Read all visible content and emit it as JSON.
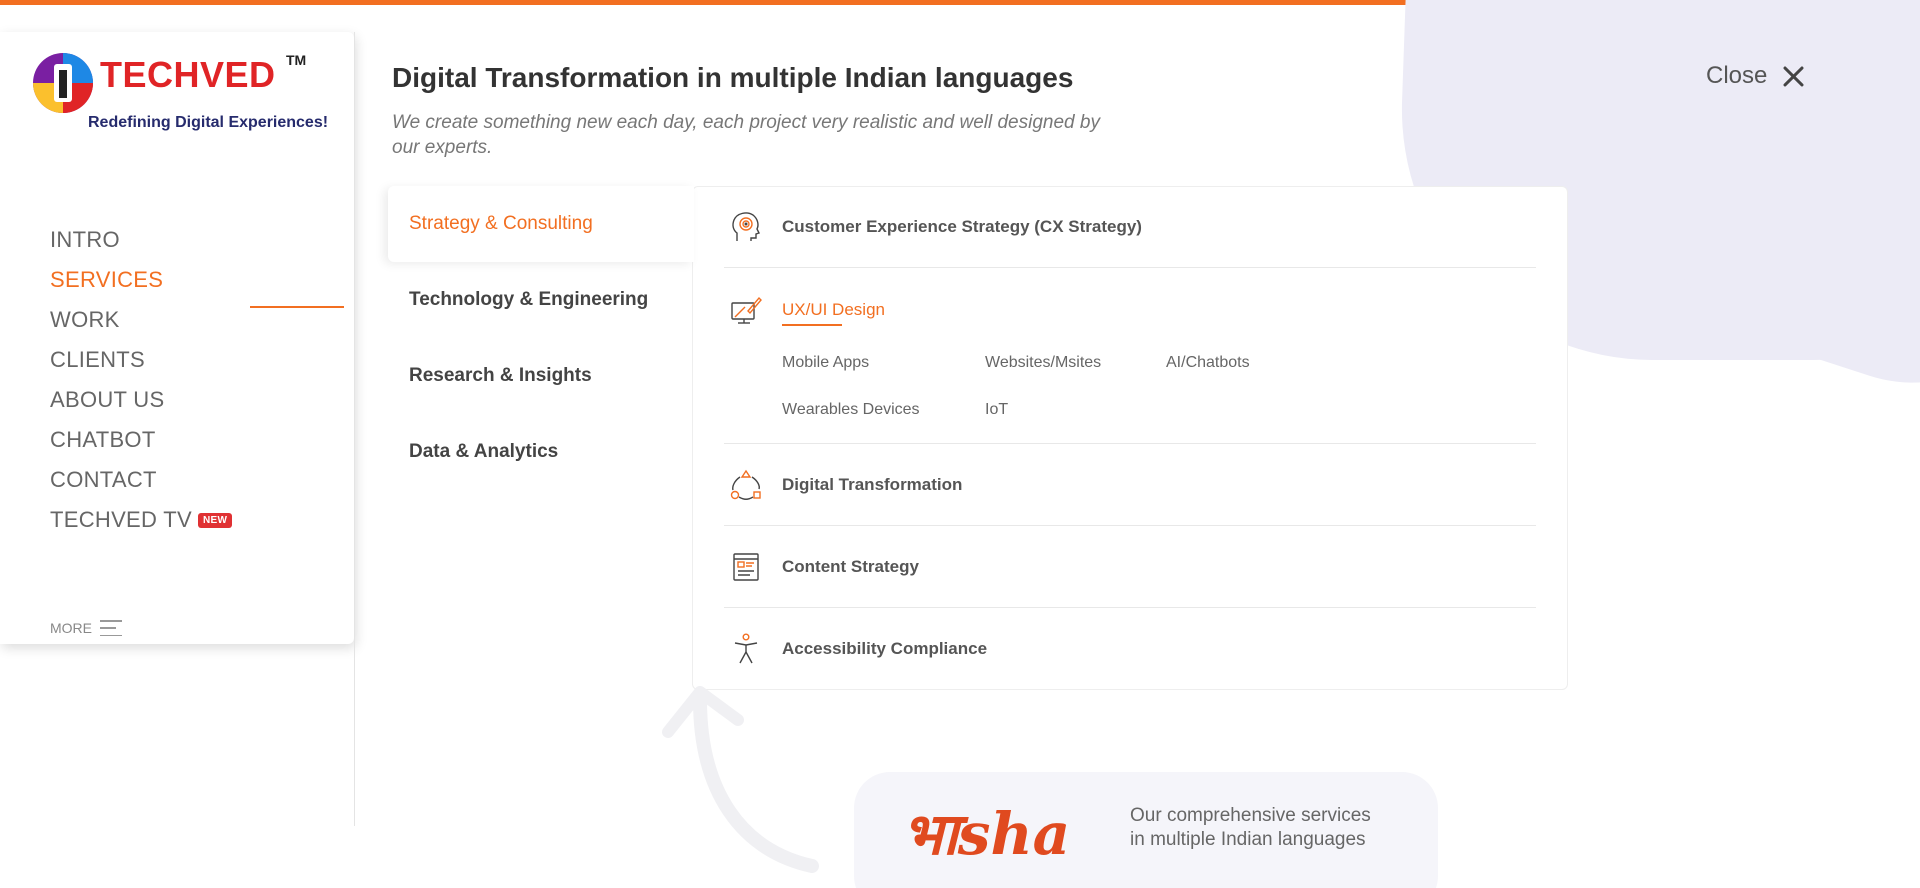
{
  "brand": {
    "name": "TECHVED",
    "trademark": "TM",
    "tagline": "Redefining Digital Experiences!"
  },
  "nav": {
    "items": [
      {
        "label": "INTRO"
      },
      {
        "label": "SERVICES",
        "active": true
      },
      {
        "label": "WORK"
      },
      {
        "label": "CLIENTS"
      },
      {
        "label": "ABOUT US"
      },
      {
        "label": "CHATBOT"
      },
      {
        "label": "CONTACT"
      },
      {
        "label": "TECHVED TV",
        "badge": "NEW"
      }
    ],
    "more_label": "MORE"
  },
  "header": {
    "title": "Digital Transformation in multiple Indian languages",
    "subtitle": "We create something new each day, each project very realistic and well designed by our experts.",
    "close_label": "Close"
  },
  "categories": [
    {
      "label": "Strategy & Consulting",
      "active": true
    },
    {
      "label": "Technology & Engineering"
    },
    {
      "label": "Research & Insights"
    },
    {
      "label": "Data & Analytics"
    }
  ],
  "services": {
    "cx": {
      "label": "Customer Experience Strategy (CX Strategy)",
      "icon": "head-target-icon"
    },
    "uxui": {
      "label": "UX/UI Design",
      "icon": "design-pen-icon",
      "subitems": [
        "Mobile Apps",
        "Websites/Msites",
        "AI/Chatbots",
        "Wearables Devices",
        "IoT"
      ]
    },
    "digital": {
      "label": "Digital Transformation",
      "icon": "cycle-shapes-icon"
    },
    "content": {
      "label": "Content Strategy",
      "icon": "document-icon"
    },
    "access": {
      "label": "Accessibility Compliance",
      "icon": "accessibility-person-icon"
    }
  },
  "bhasha": {
    "logo": "भाsha",
    "text": "Our comprehensive services in multiple Indian languages"
  },
  "colors": {
    "accent": "#f26f21",
    "badge": "#e03133",
    "blob": "#ecebf6"
  }
}
